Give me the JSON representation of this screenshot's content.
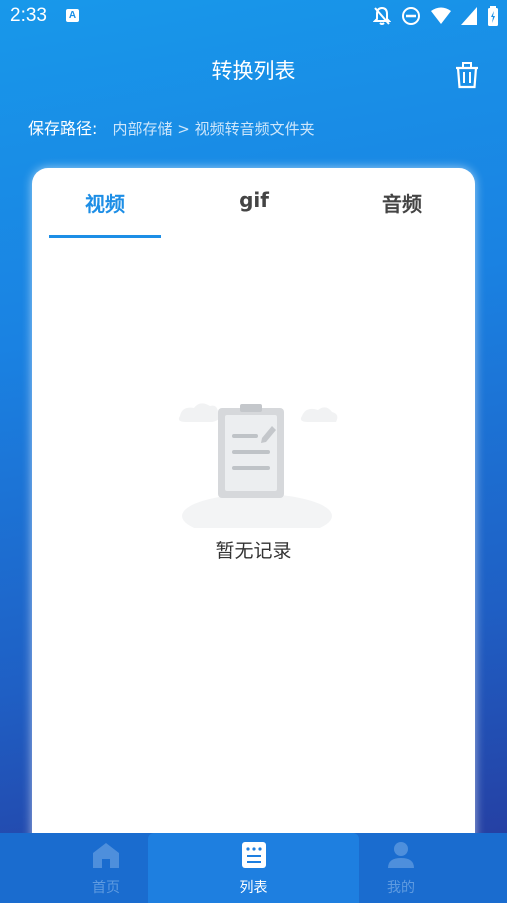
{
  "status_bar": {
    "time": "2:33",
    "notification_icon": "A"
  },
  "header": {
    "title": "转换列表",
    "delete_icon": "trash-icon"
  },
  "save_path": {
    "label": "保存路径:",
    "value": "内部存储 > 视频转音频文件夹"
  },
  "tabs": [
    {
      "label": "视频",
      "active": true
    },
    {
      "label": "gif",
      "active": false
    },
    {
      "label": "音频",
      "active": false
    }
  ],
  "empty_state": {
    "text": "暂无记录",
    "icon": "clipboard-icon"
  },
  "bottom_nav": [
    {
      "label": "首页",
      "icon": "home-icon",
      "active": false
    },
    {
      "label": "列表",
      "icon": "list-icon",
      "active": true
    },
    {
      "label": "我的",
      "icon": "profile-icon",
      "active": false
    }
  ],
  "colors": {
    "accent": "#1d8ee6",
    "nav_bg": "#1a6ccf"
  }
}
